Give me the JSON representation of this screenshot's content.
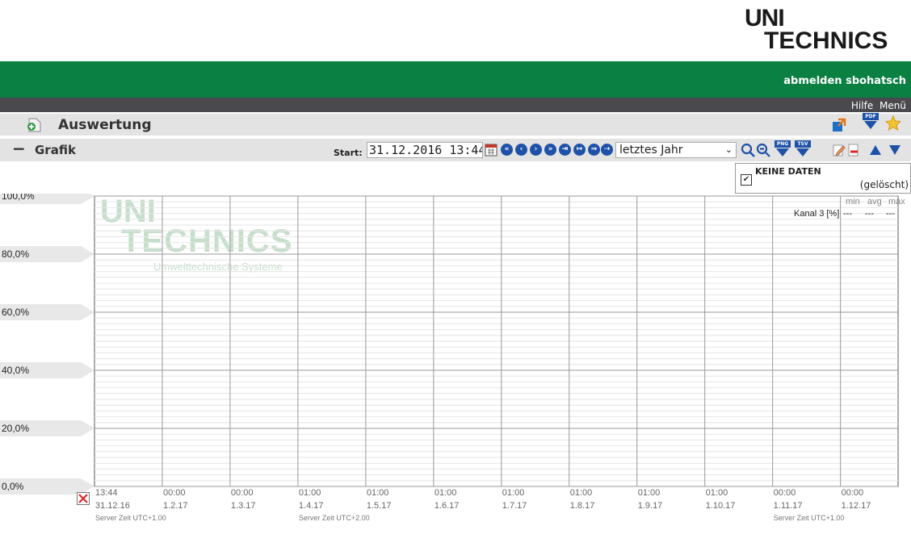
{
  "logo": {
    "line1": "UNI",
    "line2": "TECHNICS"
  },
  "header": {
    "user_link": "abmelden sbohatsch"
  },
  "topnav": {
    "help": "Hilfe",
    "menu": "Menü"
  },
  "page": {
    "title": "Auswertung",
    "icons": [
      "popout-icon",
      "pdf-download-icon",
      "favorite-star-icon"
    ]
  },
  "chart_panel": {
    "title": "Grafik",
    "start_label": "Start:",
    "start_value": "31.12.2016 13:44:",
    "range_select": "letztes Jahr",
    "download_png": "PNG",
    "download_tsv": "TSV"
  },
  "legend": {
    "name": "KEINE DATEN",
    "status": "(gelöscht)",
    "checked": true
  },
  "stats": {
    "headers": [
      "min",
      "avg",
      "max"
    ],
    "rows": [
      {
        "label": "Kanal 3 [%]",
        "min": "---",
        "avg": "---",
        "max": "---"
      }
    ]
  },
  "watermark": {
    "line1": "UNI",
    "line2": "TECHNICS",
    "line3": "Umwelttechnische Systeme"
  },
  "colors": {
    "brand_green": "#0a8043",
    "dark_bar": "#4a4a4e",
    "nav_blue": "#1e52a8",
    "watermark": "#c6dfcb"
  },
  "chart_data": {
    "type": "line",
    "y_ticks": [
      "100,0%",
      "80,0%",
      "60,0%",
      "40,0%",
      "20,0%",
      "0,0%"
    ],
    "ylim": [
      0,
      100
    ],
    "x_ticks": [
      {
        "time": "13:44",
        "date": "31.12.16"
      },
      {
        "time": "00:00",
        "date": "1.2.17"
      },
      {
        "time": "00:00",
        "date": "1.3.17"
      },
      {
        "time": "01:00",
        "date": "1.4.17"
      },
      {
        "time": "01:00",
        "date": "1.5.17"
      },
      {
        "time": "01:00",
        "date": "1.6.17"
      },
      {
        "time": "01:00",
        "date": "1.7.17"
      },
      {
        "time": "01:00",
        "date": "1.8.17"
      },
      {
        "time": "01:00",
        "date": "1.9.17"
      },
      {
        "time": "01:00",
        "date": "1.10.17"
      },
      {
        "time": "00:00",
        "date": "1.11.17"
      },
      {
        "time": "00:00",
        "date": "1.12.17"
      }
    ],
    "server_time_notes": [
      "Server Zeit UTC+1.00",
      "Server Zeit UTC+2.00",
      "Server Zeit UTC+1.00"
    ],
    "series": [
      {
        "name": "Kanal 3 [%]",
        "values": []
      }
    ],
    "grid": true
  }
}
